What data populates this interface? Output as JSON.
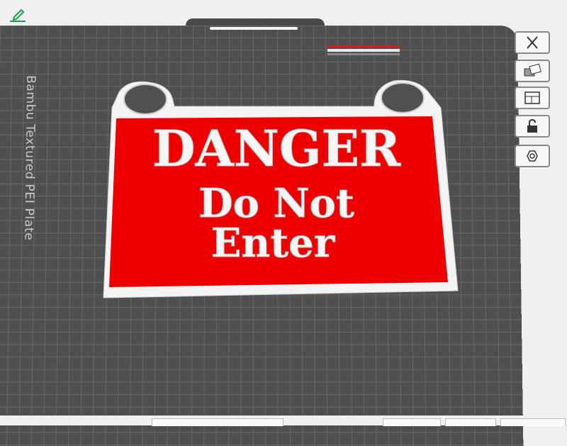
{
  "plate": {
    "label": "Bambu Textured PEI Plate"
  },
  "sign": {
    "line1": "DANGER",
    "line2": "Do Not",
    "line3": "Enter"
  },
  "toolbar": {
    "items": [
      {
        "name": "close-icon"
      },
      {
        "name": "auto-orient-icon"
      },
      {
        "name": "arrange-icon"
      },
      {
        "name": "lock-icon"
      },
      {
        "name": "hexagon-nut-icon"
      }
    ]
  },
  "colors": {
    "plate": "#4f4f4f",
    "grid": "#7a7a7a",
    "sign_red": "#ee0000",
    "sign_white": "#f4f4f4",
    "accent_green": "#1aa34a"
  }
}
